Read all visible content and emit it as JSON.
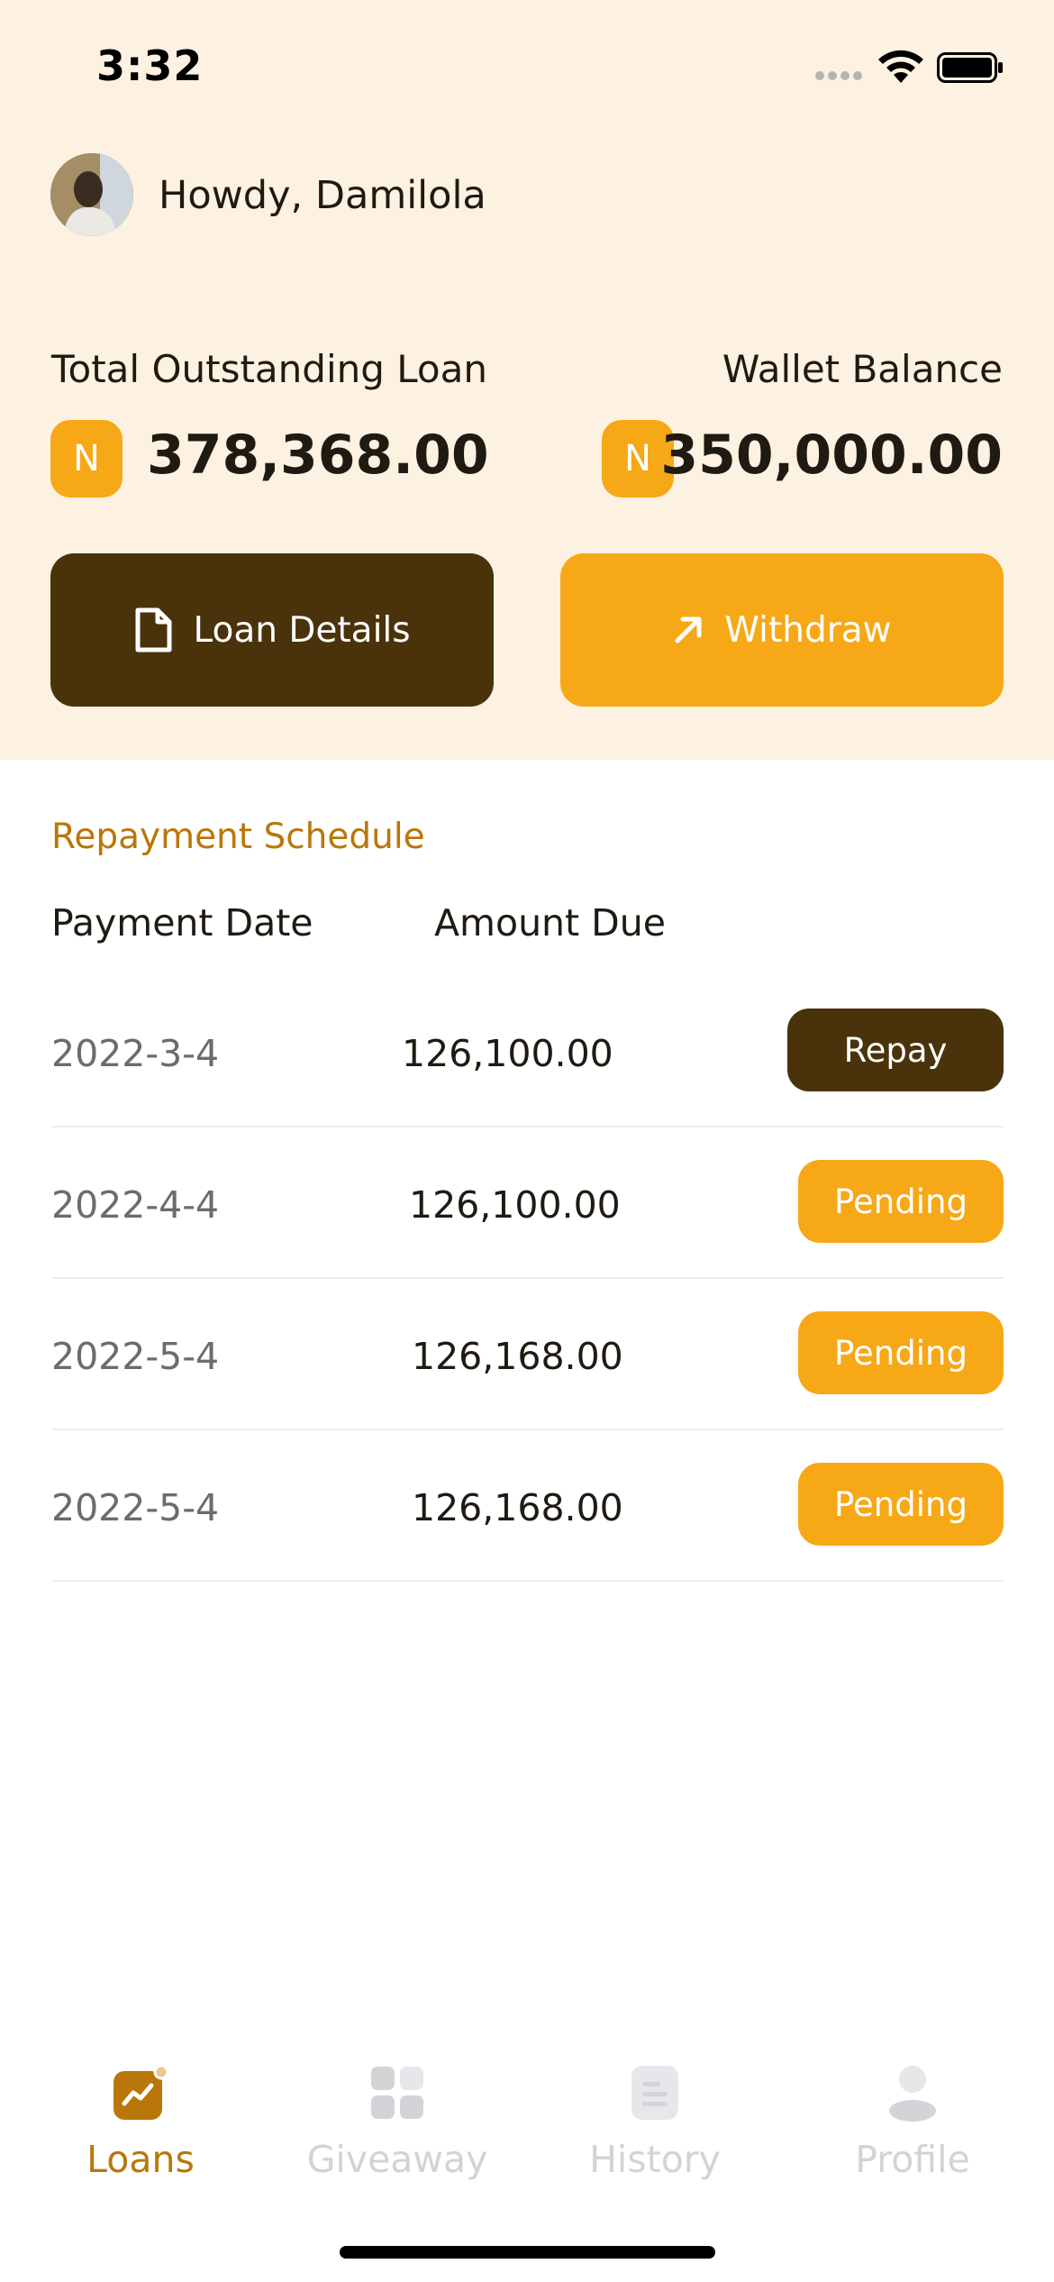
{
  "status_bar": {
    "time": "3:32"
  },
  "header": {
    "greeting": "Howdy, Damilola"
  },
  "summary": {
    "total_outstanding_label": "Total Outstanding Loan",
    "total_outstanding_currency": "N",
    "total_outstanding_amount": "378,368.00",
    "wallet_label": "Wallet Balance",
    "wallet_currency": "N",
    "wallet_amount": "350,000.00"
  },
  "actions": {
    "loan_details_label": "Loan Details",
    "withdraw_label": "Withdraw"
  },
  "schedule": {
    "title": "Repayment Schedule",
    "col_date": "Payment Date",
    "col_amount": "Amount Due",
    "rows": [
      {
        "date": "2022-3-4",
        "amount": "126,100.00",
        "action": "Repay"
      },
      {
        "date": "2022-4-4",
        "amount": "126,100.00",
        "action": "Pending"
      },
      {
        "date": "2022-5-4",
        "amount": "126,168.00",
        "action": "Pending"
      },
      {
        "date": "2022-5-4",
        "amount": "126,168.00",
        "action": "Pending"
      }
    ]
  },
  "tabbar": {
    "tabs": [
      {
        "label": "Loans",
        "icon": "loans-chart-icon",
        "active": true
      },
      {
        "label": "Giveaway",
        "icon": "grid-icon",
        "active": false
      },
      {
        "label": "History",
        "icon": "document-icon",
        "active": false
      },
      {
        "label": "Profile",
        "icon": "user-icon",
        "active": false
      }
    ]
  },
  "colors": {
    "background_top": "#fdf2e1",
    "brand_dark": "#4a330b",
    "brand_orange": "#f7a816",
    "accent_text": "#b9770a",
    "inactive_tab": "#d3d3d3"
  }
}
